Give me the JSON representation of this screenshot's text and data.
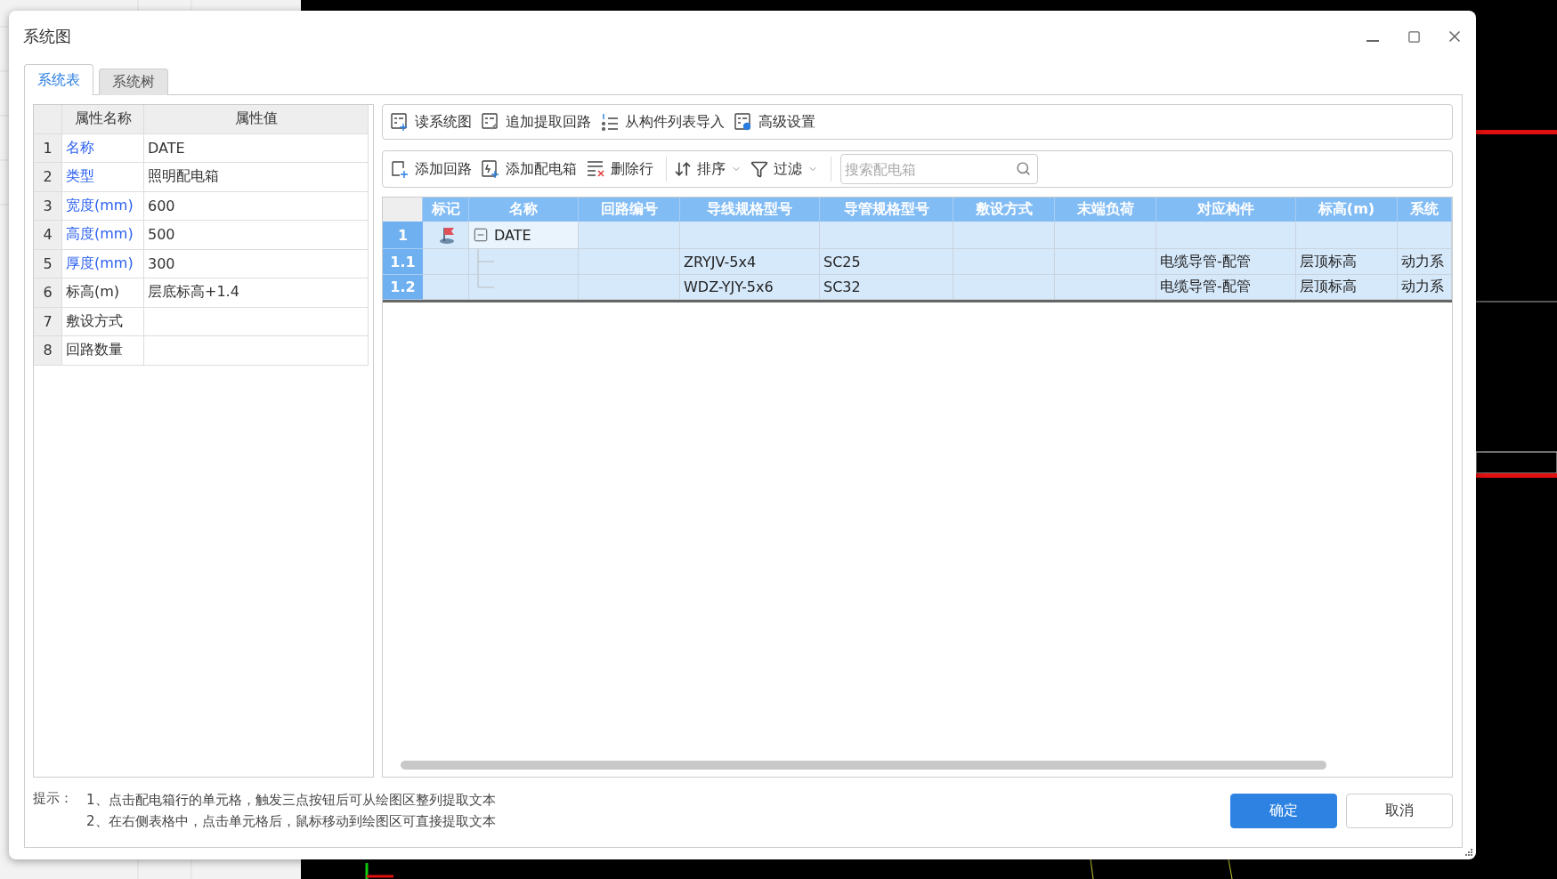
{
  "window": {
    "title": "系统图"
  },
  "tabs": [
    {
      "label": "系统表",
      "selected": true
    },
    {
      "label": "系统树",
      "selected": false
    }
  ],
  "properties": {
    "columns": [
      "属性名称",
      "属性值"
    ],
    "rows": [
      {
        "index": "1",
        "name": "名称",
        "value": "DATE",
        "highlighted": true
      },
      {
        "index": "2",
        "name": "类型",
        "value": "照明配电箱",
        "highlighted": true
      },
      {
        "index": "3",
        "name": "宽度(mm)",
        "value": "600",
        "highlighted": true
      },
      {
        "index": "4",
        "name": "高度(mm)",
        "value": "500",
        "highlighted": true
      },
      {
        "index": "5",
        "name": "厚度(mm)",
        "value": "300",
        "highlighted": true
      },
      {
        "index": "6",
        "name": "标高(m)",
        "value": "层底标高+1.4",
        "highlighted": false
      },
      {
        "index": "7",
        "name": "敷设方式",
        "highlighted": false
      },
      {
        "index": "8",
        "name": "回路数量",
        "highlighted": false
      }
    ]
  },
  "toolbar_top": [
    {
      "label": "读系统图",
      "kind": "read"
    },
    {
      "label": "追加提取回路",
      "kind": "append"
    },
    {
      "label": "从构件列表导入",
      "kind": "import"
    },
    {
      "label": "高级设置",
      "kind": "settings"
    }
  ],
  "toolbar_edit": {
    "buttons": [
      {
        "label": "添加回路",
        "kind": "add-circuit"
      },
      {
        "label": "添加配电箱",
        "kind": "add-box"
      },
      {
        "label": "删除行",
        "kind": "delete"
      }
    ],
    "menus": [
      {
        "label": "排序",
        "kind": "sort"
      },
      {
        "label": "过滤",
        "kind": "filter"
      }
    ],
    "search": {
      "placeholder": "搜索配电箱"
    }
  },
  "grid": {
    "columns": [
      "标记",
      "名称",
      "回路编号",
      "导线规格型号",
      "导管规格型号",
      "敷设方式",
      "末端负荷",
      "对应构件",
      "标高(m)",
      "系统"
    ],
    "rows": [
      {
        "index": "1",
        "name": "DATE",
        "flagged": true,
        "expanded": true,
        "focused": true,
        "children": [
          {
            "index": "1.1",
            "wire": "ZRYJV-5x4",
            "conduit": "SC25",
            "component": "电缆导管-配管",
            "elevation": "层顶标高",
            "system": "动力系"
          },
          {
            "index": "1.2",
            "wire": "WDZ-YJY-5x6",
            "conduit": "SC32",
            "component": "电缆导管-配管",
            "elevation": "层顶标高",
            "system": "动力系"
          }
        ]
      }
    ]
  },
  "hints": {
    "label": "提示：",
    "lines": [
      "1、点击配电箱行的单元格，触发三点按钮后可从绘图区整列提取文本",
      "2、在右侧表格中，点击单元格后，鼠标移动到绘图区可直接提取文本"
    ]
  },
  "buttons": [
    {
      "label": "确定",
      "kind": "primary"
    },
    {
      "label": "取消",
      "kind": "secondary"
    }
  ]
}
